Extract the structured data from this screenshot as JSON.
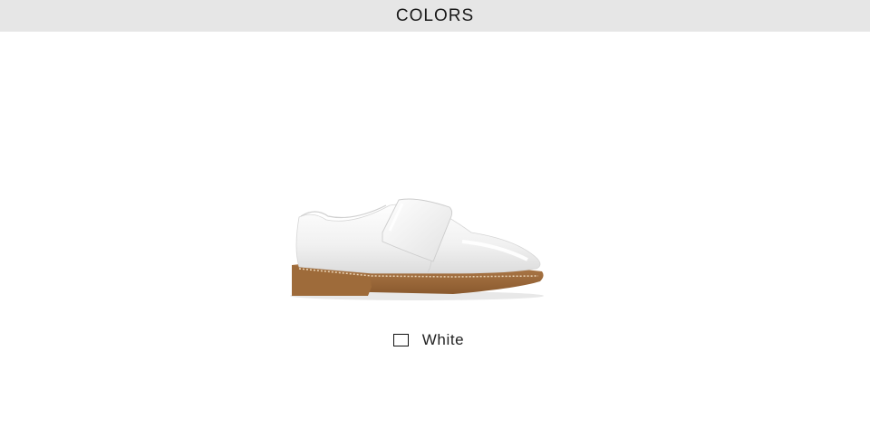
{
  "header": {
    "title": "COLORS"
  },
  "product": {
    "image_icon": "white-shoe-image",
    "colors": {
      "upper": "#f4f4f4",
      "sole": "#9c6a3e",
      "stitch": "#e9d2b4"
    }
  },
  "swatch": {
    "label": "White",
    "color": "#ffffff"
  }
}
